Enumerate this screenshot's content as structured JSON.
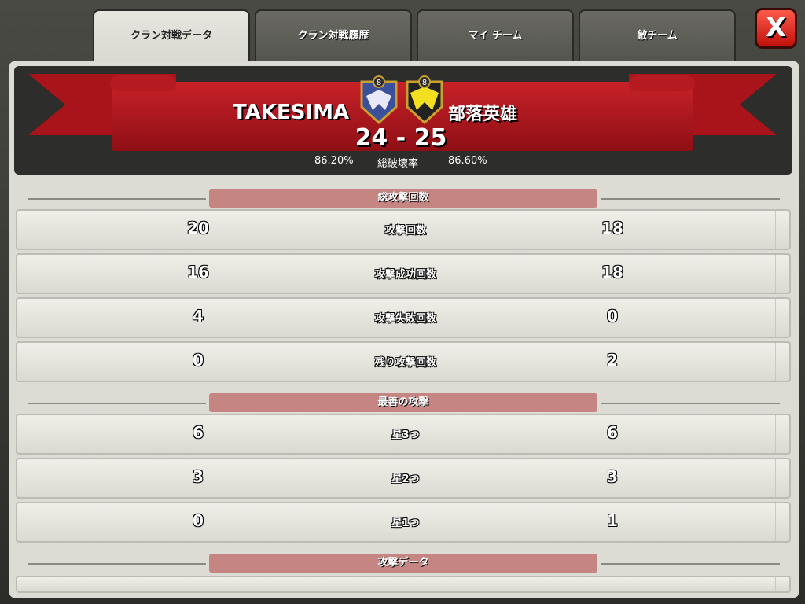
{
  "tabs": [
    {
      "label": "クラン対戦データ",
      "active": true
    },
    {
      "label": "クラン対戦履歴",
      "active": false
    },
    {
      "label": "マイ チーム",
      "active": false
    },
    {
      "label": "敵チーム",
      "active": false
    }
  ],
  "close_label": "X",
  "header": {
    "left_clan": "TAKESIMA",
    "right_clan": "部落英雄",
    "left_badge_level": "8",
    "right_badge_level": "8",
    "left_stars": "24",
    "right_stars": "25",
    "separator": "-",
    "left_destruction": "86.20%",
    "destruction_label": "総破壊率",
    "right_destruction": "86.60%"
  },
  "sections": {
    "total_attacks": {
      "title": "総攻撃回数",
      "rows": [
        {
          "left": "20",
          "label": "攻撃回数",
          "right": "18"
        },
        {
          "left": "16",
          "label": "攻撃成功回数",
          "right": "18"
        },
        {
          "left": "4",
          "label": "攻撃失敗回数",
          "right": "0"
        },
        {
          "left": "0",
          "label": "残り攻撃回数",
          "right": "2"
        }
      ]
    },
    "best_attacks": {
      "title": "最善の攻撃",
      "rows": [
        {
          "left": "6",
          "label": "星3つ",
          "right": "6"
        },
        {
          "left": "3",
          "label": "星2つ",
          "right": "3"
        },
        {
          "left": "0",
          "label": "星1つ",
          "right": "1"
        }
      ]
    },
    "attack_data": {
      "title": "攻撃データ"
    }
  },
  "colors": {
    "ribbon": "#c82128",
    "section_pill": "#c58583",
    "close_button": "#e0251a"
  }
}
